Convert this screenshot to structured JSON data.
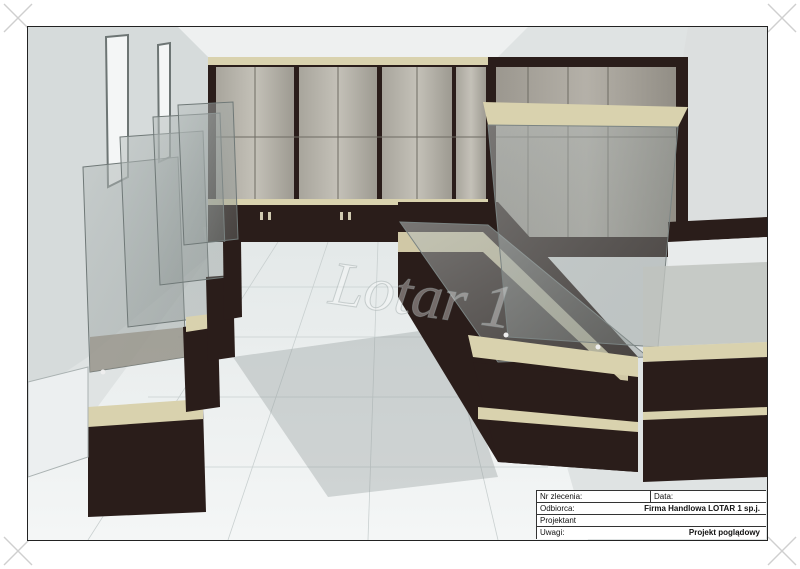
{
  "watermark": {
    "text": "Lotar 1"
  },
  "title_block": {
    "order_label": "Nr zlecenia:",
    "date_label": "Data:",
    "recipient_label": "Odbiorca:",
    "recipient_value": "Firma Handlowa LOTAR 1 sp.j.",
    "designer_label": "Projektant",
    "notes_label": "Uwagi:",
    "notes_value": "Projekt poglądowy"
  },
  "colors": {
    "furniture_dark": "#2a1d1a",
    "trim_beige": "#d9d2ae",
    "floor": "#eef1f1",
    "wall": "#dfe3e3"
  }
}
